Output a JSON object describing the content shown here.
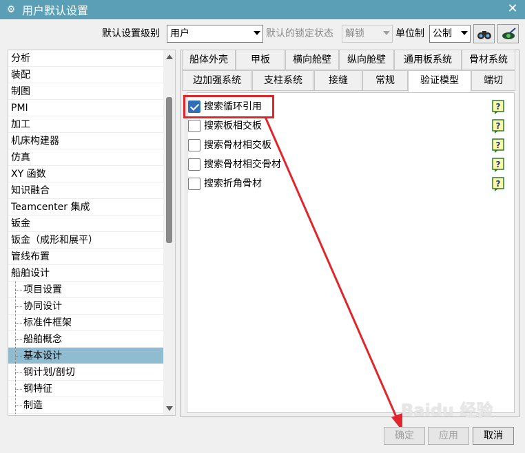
{
  "window": {
    "title": "用户默认设置",
    "close_symbol": "✕",
    "title_icon": "gear-icon"
  },
  "toolbar": {
    "level_label": "默认设置级别",
    "level_value": "用户",
    "lock_label": "默认的锁定状态",
    "lock_value": "解锁",
    "unit_label": "单位制",
    "unit_value": "公制"
  },
  "tree": {
    "items": [
      {
        "label": "分析",
        "child": false,
        "selected": false
      },
      {
        "label": "装配",
        "child": false,
        "selected": false
      },
      {
        "label": "制图",
        "child": false,
        "selected": false
      },
      {
        "label": "PMI",
        "child": false,
        "selected": false
      },
      {
        "label": "加工",
        "child": false,
        "selected": false
      },
      {
        "label": "机床构建器",
        "child": false,
        "selected": false
      },
      {
        "label": "仿真",
        "child": false,
        "selected": false
      },
      {
        "label": "XY 函数",
        "child": false,
        "selected": false
      },
      {
        "label": "知识融合",
        "child": false,
        "selected": false
      },
      {
        "label": "Teamcenter 集成",
        "child": false,
        "selected": false
      },
      {
        "label": "钣金",
        "child": false,
        "selected": false
      },
      {
        "label": "钣金（成形和展平）",
        "child": false,
        "selected": false
      },
      {
        "label": "管线布置",
        "child": false,
        "selected": false
      },
      {
        "label": "船舶设计",
        "child": false,
        "selected": false
      },
      {
        "label": "项目设置",
        "child": true,
        "selected": false
      },
      {
        "label": "协同设计",
        "child": true,
        "selected": false
      },
      {
        "label": "标准件框架",
        "child": true,
        "selected": false
      },
      {
        "label": "船舶概念",
        "child": true,
        "selected": false
      },
      {
        "label": "基本设计",
        "child": true,
        "selected": true
      },
      {
        "label": "钢计划/剖切",
        "child": true,
        "selected": false
      },
      {
        "label": "钢特征",
        "child": true,
        "selected": false
      },
      {
        "label": "制造",
        "child": true,
        "selected": false
      }
    ]
  },
  "tabs": {
    "row1": [
      "船体外壳",
      "甲板",
      "横向舱壁",
      "纵向舱壁",
      "通用板系统",
      "骨材系统"
    ],
    "row2": [
      "边加强系统",
      "支柱系统",
      "接缝",
      "常规",
      "验证模型",
      "端切"
    ],
    "active": "验证模型"
  },
  "options": [
    {
      "label": "搜索循环引用",
      "checked": true
    },
    {
      "label": "搜索板相交板",
      "checked": false
    },
    {
      "label": "搜索骨材相交板",
      "checked": false
    },
    {
      "label": "搜索骨材相交骨材",
      "checked": false
    },
    {
      "label": "搜索折角骨材",
      "checked": false
    }
  ],
  "buttons": {
    "ok": "确定",
    "apply": "应用",
    "cancel": "取消"
  },
  "watermark": "Baidu 经验",
  "colors": {
    "title_bar": "#5a9fb5",
    "selection": "#8fbcd0",
    "annotation": "#e0252b",
    "checkbox": "#2f6fb8"
  }
}
